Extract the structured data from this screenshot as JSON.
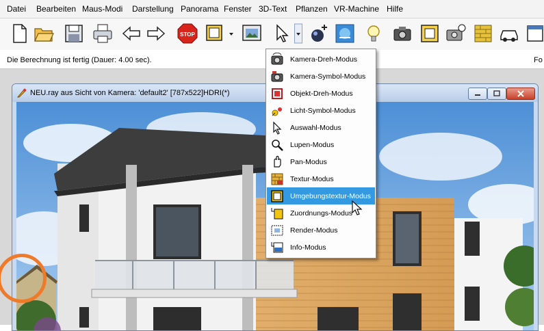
{
  "menu": [
    "Datei",
    "Bearbeiten",
    "Maus-Modi",
    "Darstellung",
    "Panorama",
    "Fenster",
    "3D-Text",
    "Pflanzen",
    "VR-Machine",
    "Hilfe"
  ],
  "toolbar": {
    "icons": [
      "new-document-icon",
      "open-folder-icon",
      "save-disk-icon",
      "print-icon",
      "back-arrow-icon",
      "forward-arrow-icon",
      "stop-icon",
      "object-mode-icon",
      "dropdown-arrow-icon",
      "render-image-icon",
      "mouse-pointer-icon",
      "dropdown-arrow-icon",
      "light-add-icon",
      "environment-texture-icon",
      "light-bulb-icon",
      "camera-icon",
      "frame-icon",
      "camera-settings-icon",
      "brick-texture-icon",
      "car-icon",
      "window-icon"
    ],
    "stop_label": "STOP"
  },
  "status": {
    "message": "Die Berechnung ist fertig (Dauer: 4.00 sec).",
    "right_text": "Fo"
  },
  "window": {
    "title": "NEU.ray aus Sicht von Kamera: 'default2' [787x522]HDRI(*)"
  },
  "dropdown": {
    "items": [
      {
        "label": "Kamera-Dreh-Modus",
        "icon": "camera-rotate-icon",
        "selected": false
      },
      {
        "label": "Kamera-Symbol-Modus",
        "icon": "camera-symbol-icon",
        "selected": false
      },
      {
        "label": "Objekt-Dreh-Modus",
        "icon": "object-rotate-icon",
        "selected": false
      },
      {
        "label": "Licht-Symbol-Modus",
        "icon": "light-symbol-icon",
        "selected": false
      },
      {
        "label": "Auswahl-Modus",
        "icon": "selection-arrow-icon",
        "selected": false
      },
      {
        "label": "Lupen-Modus",
        "icon": "magnifier-icon",
        "selected": false
      },
      {
        "label": "Pan-Modus",
        "icon": "hand-pan-icon",
        "selected": false
      },
      {
        "label": "Textur-Modus",
        "icon": "texture-icon",
        "selected": false
      },
      {
        "label": "Umgebungstextur-Modus",
        "icon": "environment-texture-icon",
        "selected": true
      },
      {
        "label": "Zuordnungs-Modus",
        "icon": "mapping-icon",
        "selected": false
      },
      {
        "label": "Render-Modus",
        "icon": "render-icon",
        "selected": false
      },
      {
        "label": "Info-Modus",
        "icon": "info-icon",
        "selected": false
      }
    ]
  },
  "colors": {
    "menu_selection": "#3399e0",
    "highlight_circle": "#ee7a2a"
  }
}
